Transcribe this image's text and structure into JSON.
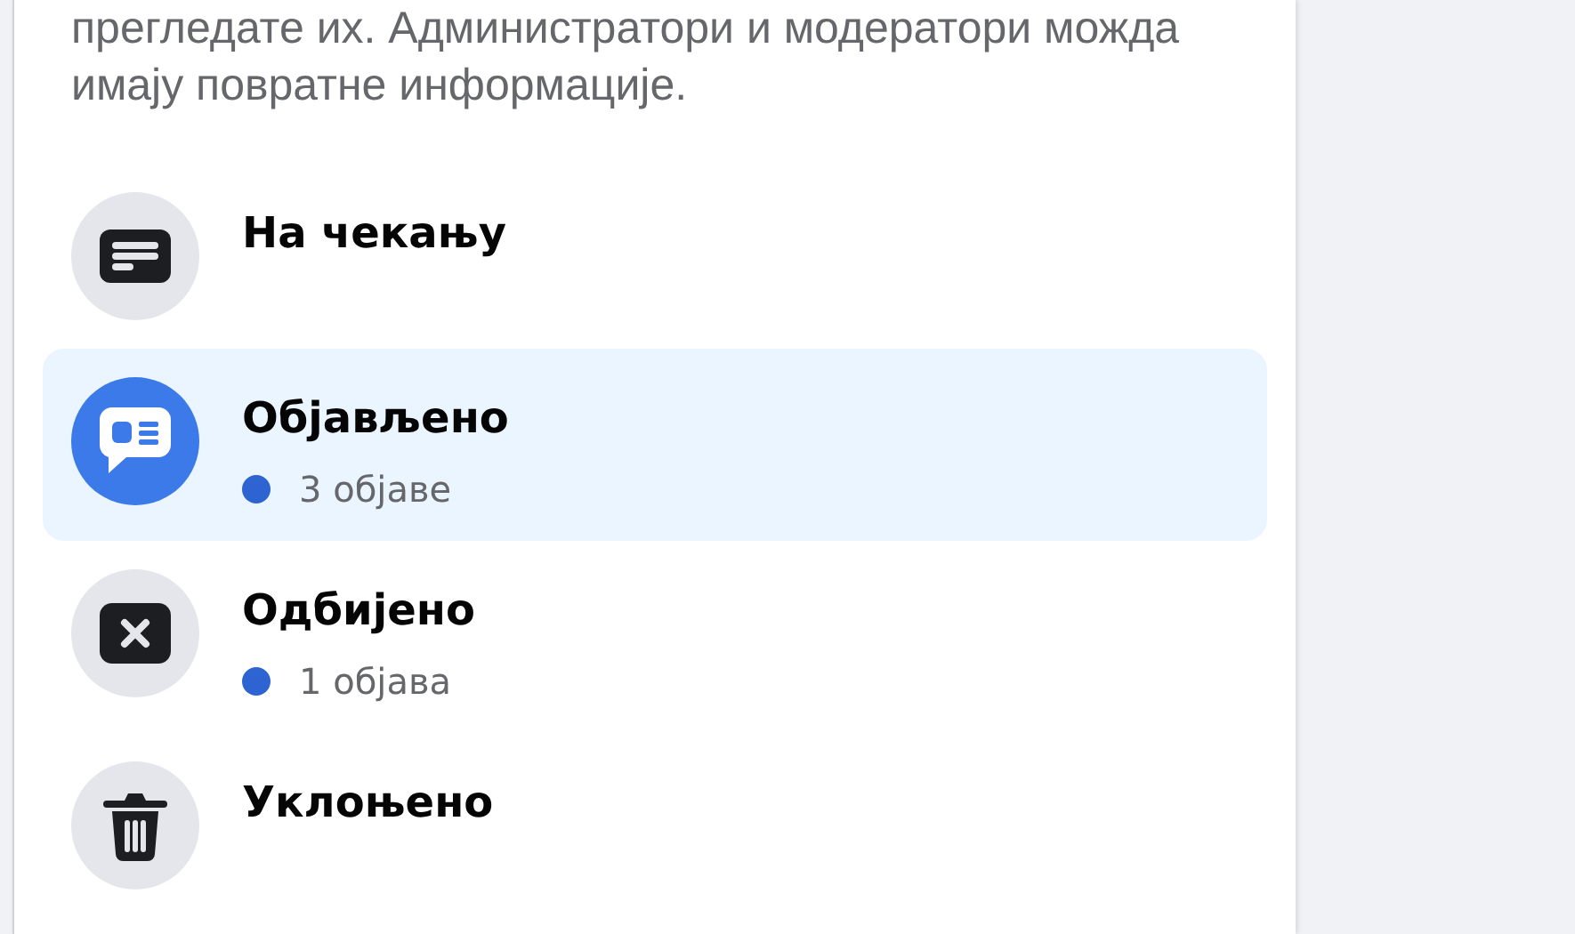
{
  "description": "прегледате их. Администратори и модератори можда имају повратне информације.",
  "items": [
    {
      "title": "На чекању",
      "selected": false
    },
    {
      "title": "Објављено",
      "count": "3 објаве",
      "selected": true
    },
    {
      "title": "Одбијено",
      "count": "1 објава",
      "selected": false
    },
    {
      "title": "Уклоњено",
      "selected": false
    }
  ]
}
